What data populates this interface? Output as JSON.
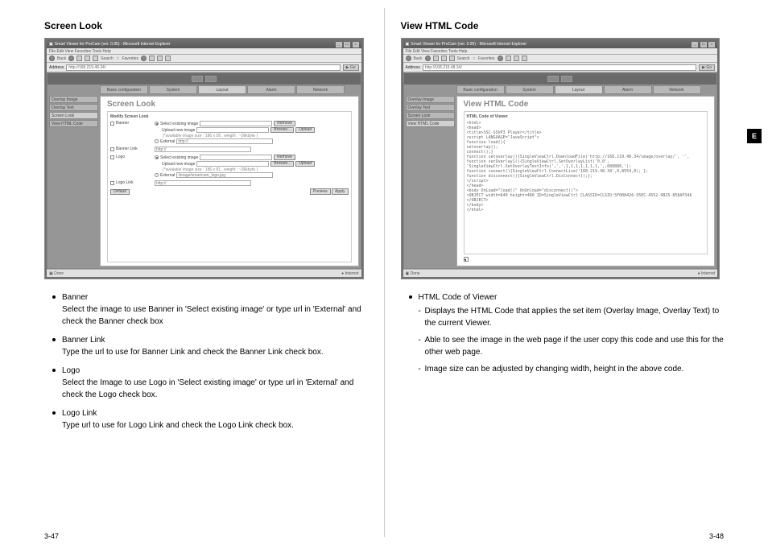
{
  "left": {
    "title": "Screen Look",
    "browser": {
      "titlebar": "Smart Viewer for ProCam (ver. 0.95) - Microsoft Internet Explorer",
      "menu": "File  Edit  View  Favorites  Tools  Help",
      "toolbar": {
        "back": "Back",
        "search": "Search",
        "favorites": "Favorites"
      },
      "address_label": "Address",
      "address": "http://168.219.48.34/",
      "go": "Go",
      "tabs": [
        "Basic configuration",
        "System",
        "Layout",
        "Alarm",
        "Network"
      ],
      "side": [
        "Overlay Image",
        "Overlay Text",
        "Screen Look",
        "View HTML Code"
      ],
      "pane_title": "Screen Look",
      "panel_header": "Modify Screen Look",
      "rows": {
        "banner": "Banner",
        "banner_link": "Banner Link",
        "logo": "Logo",
        "logo_link": "Logo Link"
      },
      "labels": {
        "select_existing": "Select existing image",
        "upload_new": "Upload new image",
        "external": "External",
        "hint_banner": "(*available image size : 186 x 58 , weight : ~36kbyte )",
        "hint_logo": "(*available image size : 186 x 81 , weight : ~36kbyte )",
        "http": "http://",
        "logo_ext": "/image/smartcam_logo.jpg",
        "browse": "Browse...",
        "upload": "Upload",
        "remove": "Remove"
      },
      "buttons": {
        "default": "Default",
        "preview": "Preview",
        "apply": "Apply"
      },
      "status_left": "Done",
      "status_right": "Internet"
    },
    "bullets": [
      {
        "label": "Banner",
        "desc": "Select the image to use Banner in 'Select existing image' or type url in 'External' and check the Banner check box"
      },
      {
        "label": "Banner Link",
        "desc": "Type the url to use for Banner Link and check the Banner Link check box."
      },
      {
        "label": "Logo",
        "desc": "Select the Image to use Logo in 'Select existing image' or type url in 'External' and check the Logo check box."
      },
      {
        "label": "Logo Link",
        "desc": "Type url to use for Logo Link and check the Logo Link check box."
      }
    ],
    "pagenum": "3-47"
  },
  "right": {
    "title": "View HTML Code",
    "browser": {
      "titlebar": "Smart Viewer for ProCam (ver. 0.95) - Microsoft Internet Explorer",
      "menu": "File  Edit  View  Favorites  Tools  Help",
      "address_label": "Address",
      "address": "http://168.219.48.34/",
      "go": "Go",
      "tabs": [
        "Basic configuration",
        "System",
        "Layout",
        "Alarm",
        "Network"
      ],
      "side": [
        "Overlay Image",
        "Overlay Text",
        "Screen Look",
        "View HTML Code"
      ],
      "pane_title": "View HTML Code",
      "panel_header": "HTML Code of Viewer",
      "code": "<html>\n<head>\n<title>SSC-SSVP3 Player</title>\n<script LANGUAGE=\"JavaScript\">\nfunction load(){\nsetoverlay();\nconnect();}\nfunction setoverlay(){SingleViewCtrl.DownloadFile('http://168.219.48.34/image/overlay/', '',\nfunction setOverlay1(){SingleViewCtrl.SetOverlayList('0,0',\n'SingleViewCtrl.SetOverlayTextInfo(',',',1,1,1,1,1,1,1,',,088888,');\nfunction connect(){SingleViewCtrl.ConnectLive('168.219.48.34',0,8554,0); };\nfunction disconnect(){SingleViewCtrl.DisConnect();};\n</script>\n</head>\n<body OnLoad=\"load()\" OnUnload=\"disconnect()\">\n<OBJECT width=640 height=480 ID=SingleViewCtrl CLASSID=CLSID:5F008426-55EC-4552-9825-858AF346\n</OBJECT>\n</body>\n</html>\n",
      "status_left": "Done",
      "status_right": "Internet"
    },
    "bullets": [
      {
        "label": "HTML Code of Viewer",
        "dashes": [
          "Displays the HTML Code that applies the set item (Overlay Image, Overlay Text) to the current Viewer.",
          "Able to see the image in the web page if the user copy this code and use this for the other web page.",
          "Image size can be adjusted by changing width, height in the above code."
        ]
      }
    ],
    "pagenum": "3-48",
    "side_tab": "E"
  }
}
